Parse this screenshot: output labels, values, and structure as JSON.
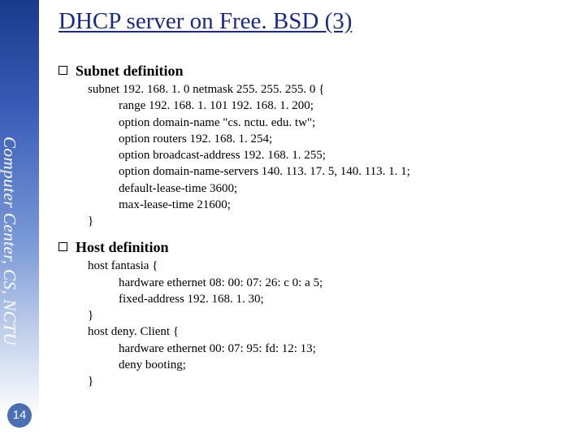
{
  "sidebar": {
    "org_text": "Computer Center, CS, NCTU"
  },
  "page_number": "14",
  "title": "DHCP server on Free. BSD (3)",
  "sections": [
    {
      "title": "Subnet definition",
      "code": [
        {
          "t": "subnet 192. 168. 1. 0 netmask 255. 255. 255. 0 {",
          "i": 0
        },
        {
          "t": "range 192. 168. 1. 101 192. 168. 1. 200;",
          "i": 1
        },
        {
          "t": "option domain-name \"cs. nctu. edu. tw\";",
          "i": 1
        },
        {
          "t": "option routers 192. 168. 1. 254;",
          "i": 1
        },
        {
          "t": "option broadcast-address 192. 168. 1. 255;",
          "i": 1
        },
        {
          "t": "option domain-name-servers 140. 113. 17. 5, 140. 113. 1. 1;",
          "i": 1
        },
        {
          "t": "default-lease-time 3600;",
          "i": 1
        },
        {
          "t": "max-lease-time 21600;",
          "i": 1
        },
        {
          "t": "}",
          "i": 0
        }
      ]
    },
    {
      "title": "Host definition",
      "code": [
        {
          "t": "host fantasia {",
          "i": 0
        },
        {
          "t": "hardware ethernet 08: 00: 07: 26: c 0: a 5;",
          "i": 1
        },
        {
          "t": "fixed-address 192. 168. 1. 30;",
          "i": 1
        },
        {
          "t": "}",
          "i": 0
        },
        {
          "t": "host deny. Client {",
          "i": 0
        },
        {
          "t": "hardware ethernet 00: 07: 95: fd: 12: 13;",
          "i": 1
        },
        {
          "t": "deny booting;",
          "i": 1
        },
        {
          "t": "}",
          "i": 0
        }
      ]
    }
  ]
}
